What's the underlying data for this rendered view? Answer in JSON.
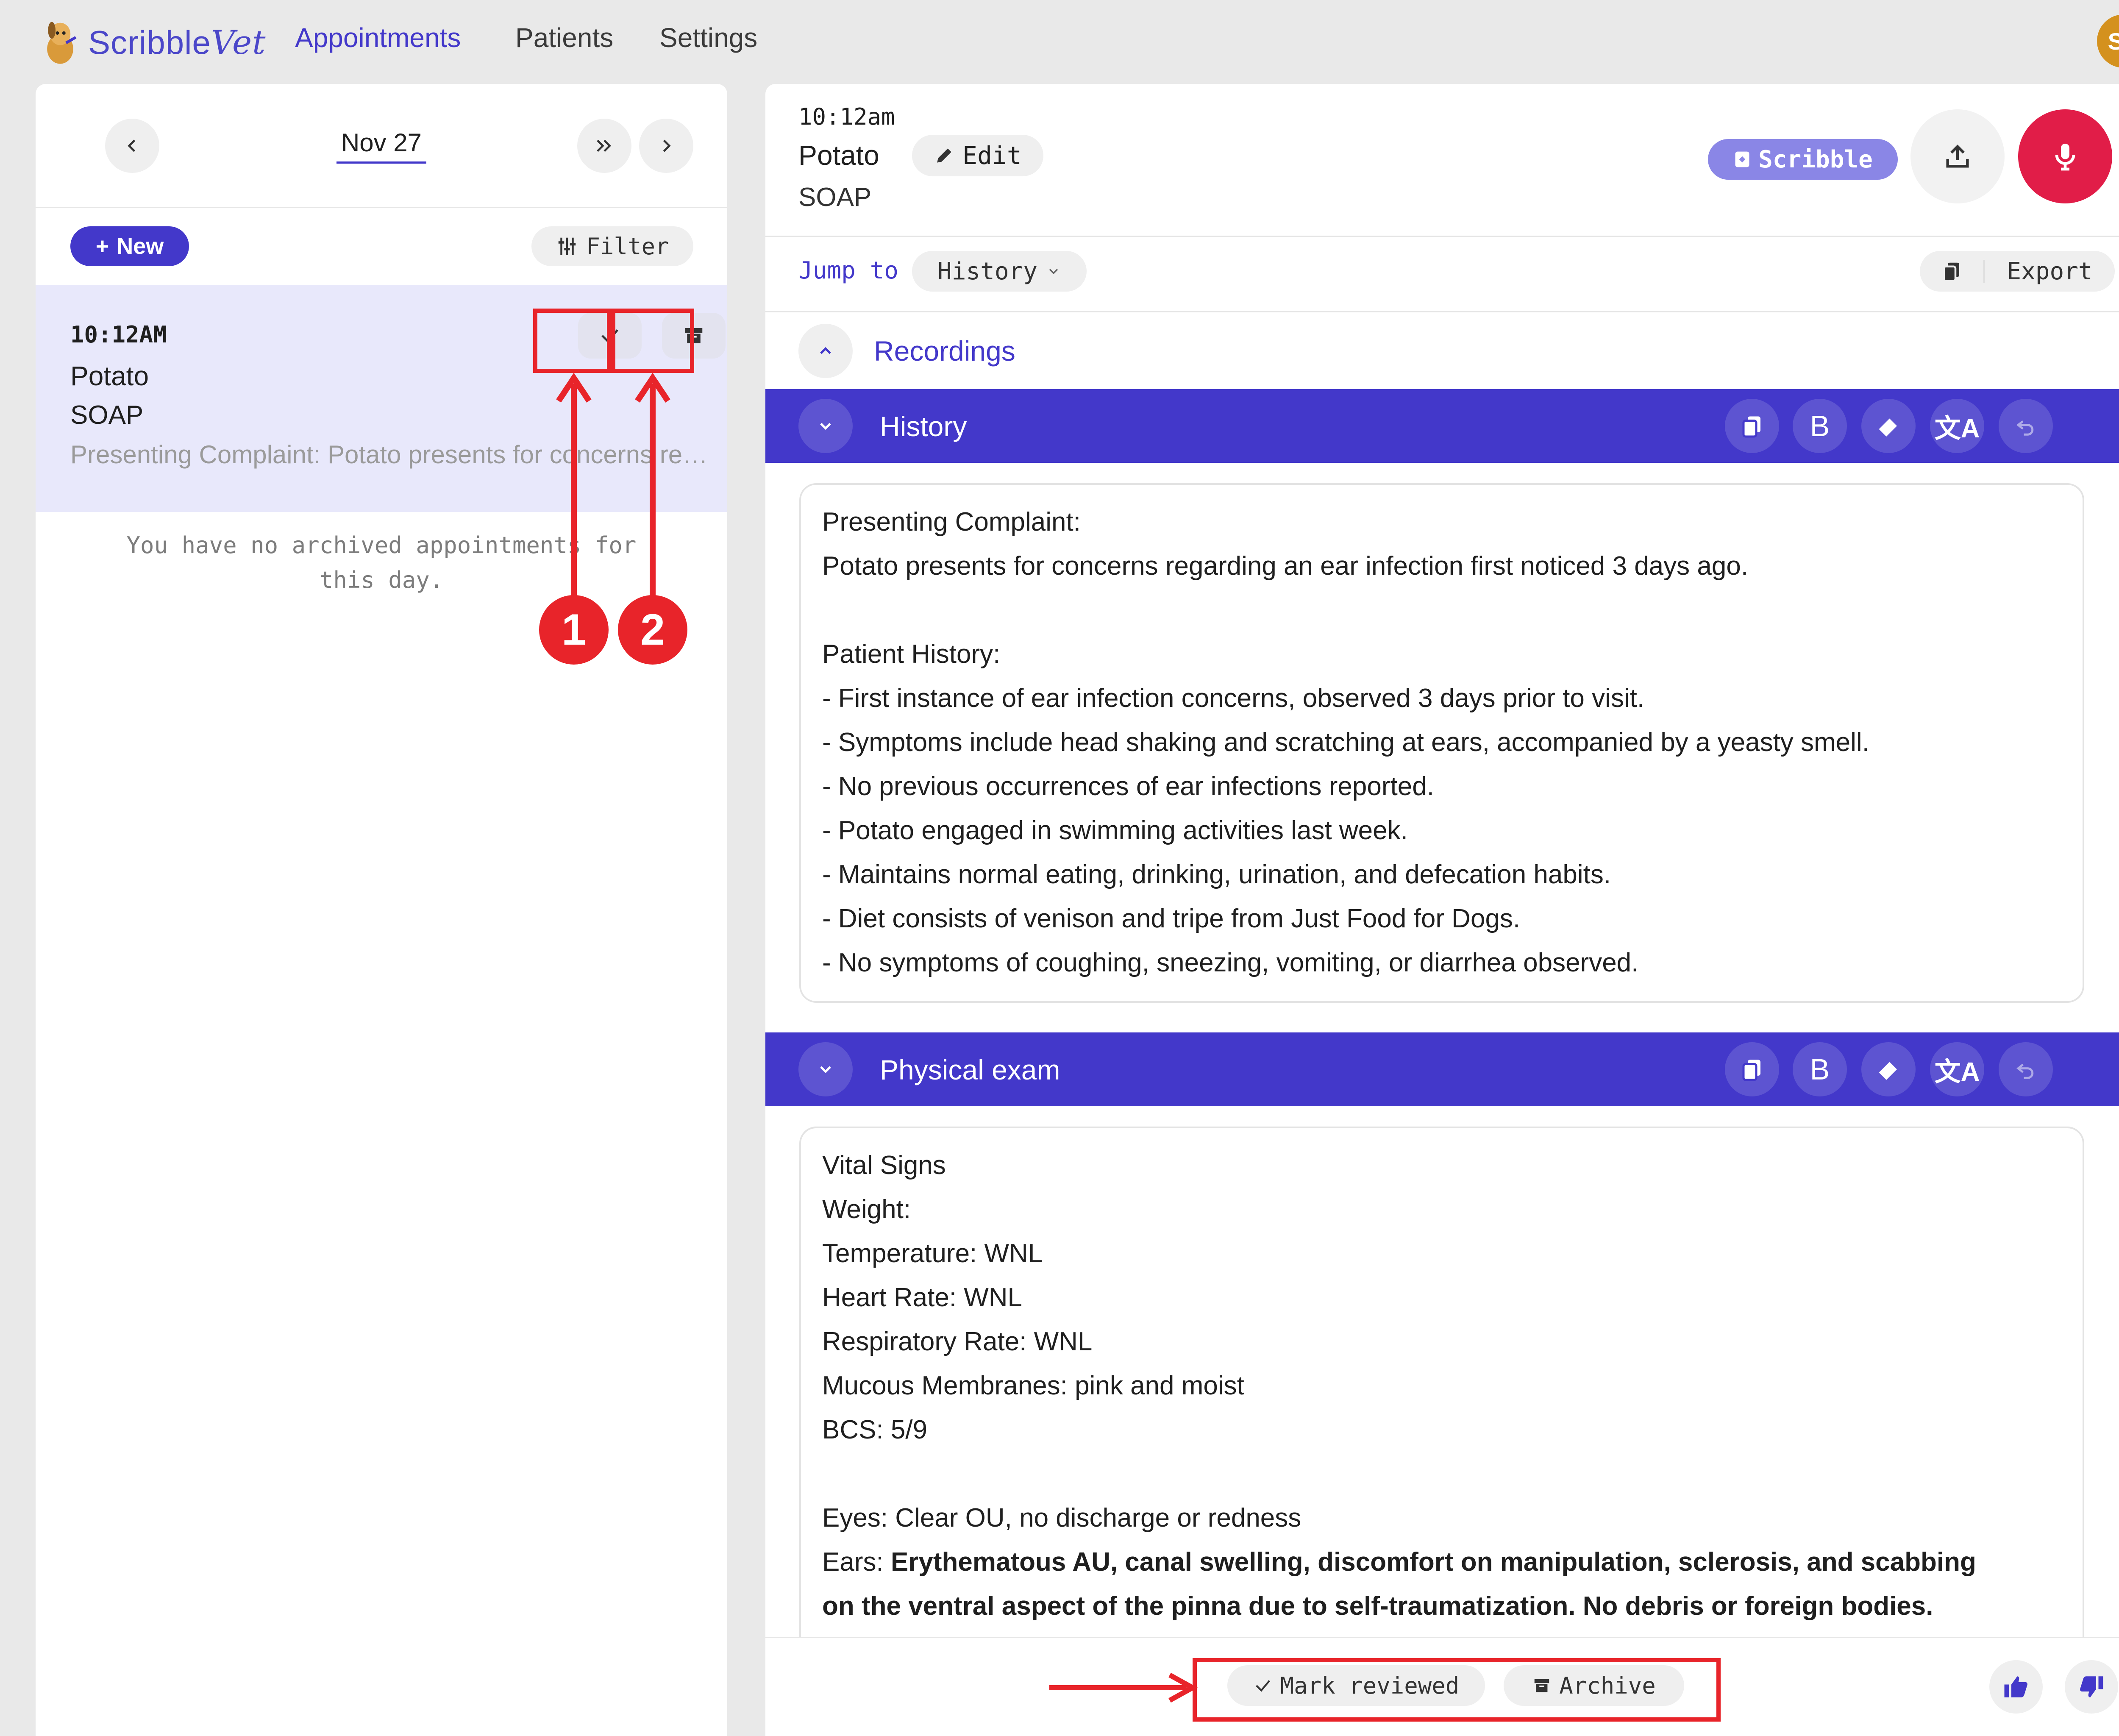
{
  "app": {
    "logo_text_a": "Scribble",
    "logo_text_b": "Vet",
    "avatar_initials": "SV"
  },
  "nav": {
    "appointments": "Appointments",
    "patients": "Patients",
    "settings": "Settings"
  },
  "left": {
    "date": "Nov 27",
    "new_label": "New",
    "filter_label": "Filter",
    "appointment": {
      "time": "10:12AM",
      "name": "Potato",
      "type": "SOAP",
      "preview": "Presenting Complaint: Potato presents for concerns regarding an ear infection first noticed 3 days ago."
    },
    "no_archived": [
      "You have no archived appointments for",
      "this day."
    ]
  },
  "right": {
    "time": "10:12am",
    "name": "Potato",
    "type": "SOAP",
    "edit_label": "Edit",
    "scribble_label": "Scribble",
    "jump_to_label": "Jump to",
    "jump_selected": "History",
    "export_label": "Export",
    "recordings_label": "Recordings",
    "history": {
      "title": "History",
      "lines": [
        "Presenting Complaint:",
        "Potato presents for concerns regarding an ear infection first noticed 3 days ago.",
        "",
        "Patient History:",
        "- First instance of ear infection concerns, observed 3 days prior to visit.",
        "- Symptoms include head shaking and scratching at ears, accompanied by a yeasty smell.",
        "- No previous occurrences of ear infections reported.",
        "- Potato engaged in swimming activities last week.",
        "- Maintains normal eating, drinking, urination, and defecation habits.",
        "- Diet consists of venison and tripe from Just Food for Dogs.",
        "- No symptoms of coughing, sneezing, vomiting, or diarrhea observed."
      ]
    },
    "physical_exam": {
      "title": "Physical exam",
      "lines": [
        "Vital Signs",
        "Weight:",
        "Temperature: WNL",
        "Heart Rate: WNL",
        "Respiratory Rate: WNL",
        "Mucous Membranes: pink and moist",
        "BCS: 5/9",
        "",
        "Eyes: Clear OU, no discharge or redness"
      ],
      "ears_label": "Ears: ",
      "ears_bold_1": "Erythematous AU, canal swelling, discomfort on manipulation, sclerosis, and scabbing",
      "ears_bold_2": "on the ventral aspect of the pinna due to self-traumatization. No debris or foreign bodies."
    },
    "mark_reviewed_label": "Mark reviewed",
    "archive_label": "Archive"
  },
  "annotations": {
    "badge_1": "1",
    "badge_2": "2"
  },
  "colors": {
    "accent": "#4338ca",
    "highlight": "#e8242a",
    "mic": "#e11d48",
    "avatar": "#d4911e",
    "scribble": "#8a86e6"
  },
  "icons": [
    "chevron-left-icon",
    "chevron-right-icon",
    "double-chevron-right-icon",
    "plus-icon",
    "filter-icon",
    "check-icon",
    "archive-icon",
    "pencil-icon",
    "upload-icon",
    "microphone-icon",
    "copy-icon",
    "bold-icon",
    "eraser-icon",
    "translate-icon",
    "undo-icon",
    "thumbs-up-icon",
    "thumbs-down-icon"
  ]
}
